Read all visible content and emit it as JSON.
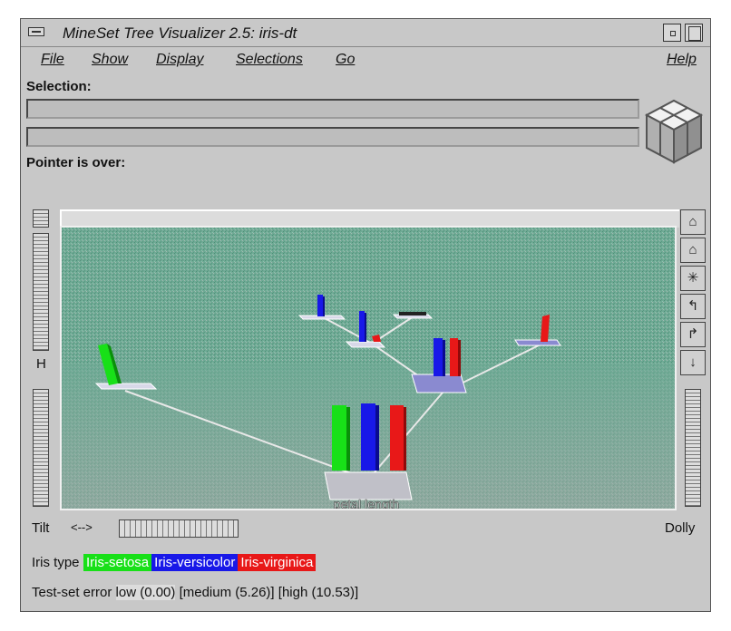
{
  "window": {
    "title": "MineSet Tree Visualizer 2.5: iris-dt"
  },
  "menubar": {
    "items": [
      "File",
      "Show",
      "Display",
      "Selections",
      "Go"
    ],
    "help": "Help"
  },
  "selection": {
    "label": "Selection:",
    "field1": "",
    "field2": ""
  },
  "pointer": {
    "label": "Pointer is over:"
  },
  "viewer": {
    "h_label": "H",
    "tilt_label": "Tilt",
    "tilt_arrows": "<-->",
    "dolly_label": "Dolly",
    "root_node_label": "petal length",
    "colors": {
      "background": "#6faa95",
      "setosa": "#18e018",
      "versicolor": "#1818e8",
      "virginica": "#e81818",
      "base": "#c0c0c8"
    }
  },
  "legend": {
    "label": "Iris type",
    "classes": [
      {
        "name": "Iris-setosa",
        "color": "#18e018"
      },
      {
        "name": "Iris-versicolor",
        "color": "#1818e8"
      },
      {
        "name": "Iris-virginica",
        "color": "#e81818"
      }
    ]
  },
  "error": {
    "label": "Test-set error",
    "low": "low (0.00)",
    "medium": "[medium (5.26)]",
    "high": "[high (10.53)]"
  },
  "toolbar_icons": [
    "home-icon",
    "set-home-icon",
    "view-all-icon",
    "rotate-left-icon",
    "rotate-right-icon",
    "go-down-icon"
  ]
}
